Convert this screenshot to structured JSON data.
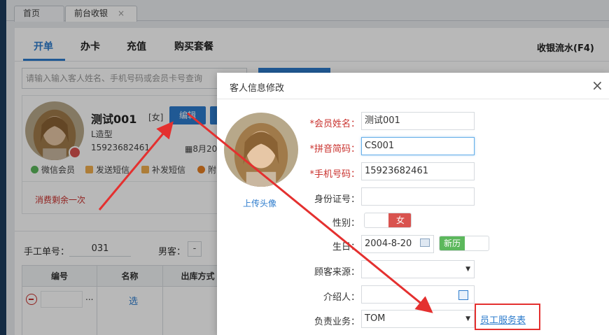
{
  "tabs": [
    {
      "label": "首页"
    },
    {
      "label": "前台收银",
      "close": "×"
    }
  ],
  "main": {
    "subtabs": [
      "开单",
      "办卡",
      "充值",
      "购买套餐"
    ],
    "right_link": "收银流水(F4)",
    "search_placeholder": "请输入输入客人姓名、手机号码或会员卡号查询",
    "member": {
      "name": "测试001",
      "gender": "[女]",
      "edit_label": "编辑",
      "level": "L造型",
      "phone": "15923682461",
      "date": "8月20",
      "actions": [
        "微信会员",
        "发送短信",
        "补发短信",
        "附"
      ],
      "remaining": "消费剩余一次"
    },
    "lower": {
      "manual_label": "手工单号：",
      "manual_value": "031",
      "male_label": "男客：",
      "minus": "-",
      "columns": [
        "编号",
        "名称",
        "出库方式"
      ],
      "row_dots": "...",
      "row_select": "选"
    }
  },
  "modal": {
    "title": "客人信息修改",
    "close": "×",
    "upload_label": "上传头像",
    "fields": {
      "name_label": "会员姓名：",
      "name_value": "测试001",
      "pinyin_label": "拼音简码：",
      "pinyin_value": "CS001",
      "phone_label": "手机号码：",
      "phone_value": "15923682461",
      "id_label": "身份证号：",
      "sex_label": "性别：",
      "sex_value": "女",
      "birthday_label": "生日：",
      "birthday_value": "2004-8-20",
      "calendar_value": "新历",
      "source_label": "顾客来源：",
      "referrer_label": "介绍人：",
      "staff_label": "负责业务：",
      "staff_value": "TOM",
      "staff_link": "员工服务表"
    }
  },
  "colors": {
    "accent": "#2d7ccd",
    "required": "#c9302c",
    "annotation": "#e4302f",
    "toggle_green": "#5cb85c"
  }
}
